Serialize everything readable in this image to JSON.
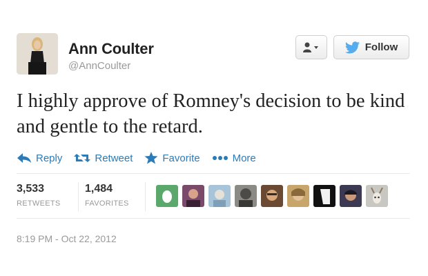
{
  "user": {
    "display_name": "Ann Coulter",
    "screen_name": "@AnnCoulter"
  },
  "buttons": {
    "user_dropdown_icon": "person-icon",
    "follow_label": "Follow"
  },
  "tweet": {
    "text": "I highly approve of Romney's decision to be kind and gentle to the retard."
  },
  "actions": [
    {
      "label": "Reply",
      "icon": "reply-arrow-icon"
    },
    {
      "label": "Retweet",
      "icon": "retweet-icon"
    },
    {
      "label": "Favorite",
      "icon": "star-icon"
    },
    {
      "label": "More",
      "icon": "ellipsis-icon"
    }
  ],
  "stats": {
    "retweets_count": "3,533",
    "retweets_label": "RETWEETS",
    "favorites_count": "1,484",
    "favorites_label": "FAVORITES"
  },
  "favoriters": [
    {
      "color": "#5aa86b"
    },
    {
      "color": "#7a4a6b"
    },
    {
      "color": "#a8c4d8"
    },
    {
      "color": "#6b6a66"
    },
    {
      "color": "#b58a5a"
    },
    {
      "color": "#c8a56a"
    },
    {
      "color": "#222222"
    },
    {
      "color": "#3b3a52"
    },
    {
      "color": "#c9c7c2"
    }
  ],
  "timestamp": "8:19 PM - Oct 22, 2012",
  "colors": {
    "link_blue": "#2b7bb9",
    "twitter_bird": "#55acee",
    "muted_gray": "#999999"
  }
}
